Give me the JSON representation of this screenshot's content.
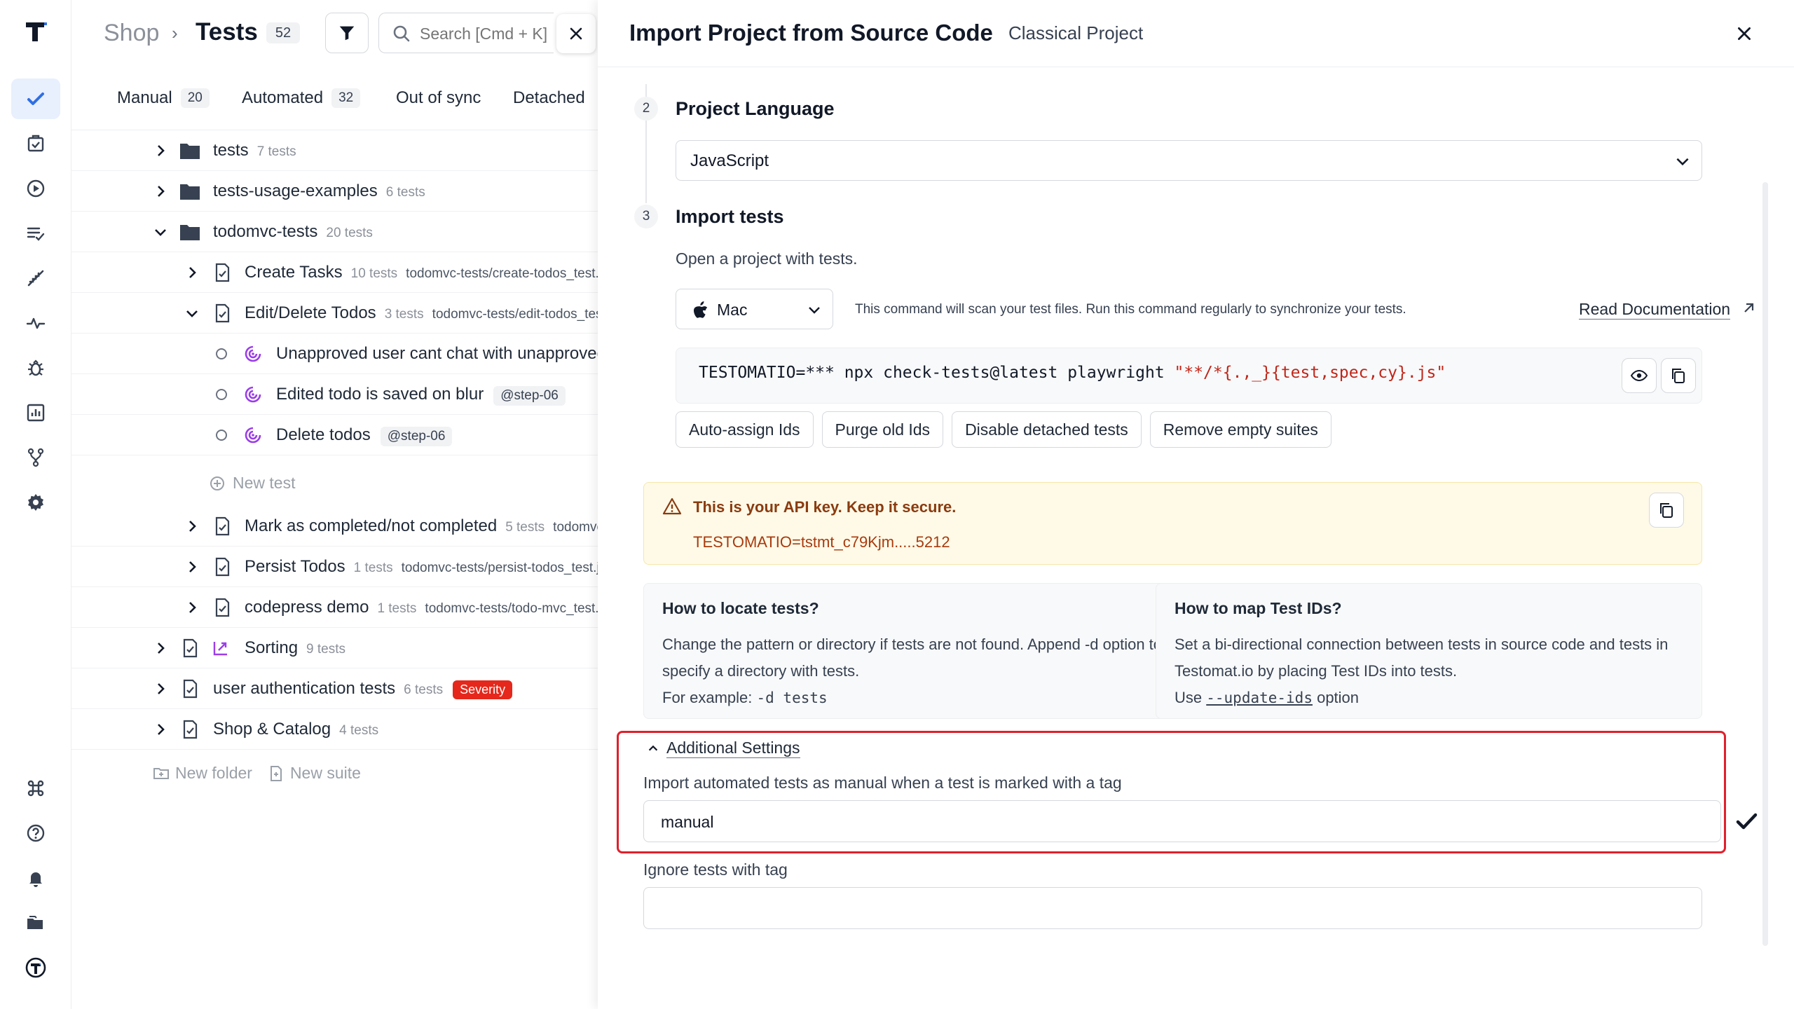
{
  "breadcrumb": {
    "shop": "Shop",
    "sep": "›",
    "title": "Tests",
    "count": "52"
  },
  "search": {
    "placeholder": "Search [Cmd + K]"
  },
  "tabs": [
    {
      "label": "Manual",
      "count": "20"
    },
    {
      "label": "Automated",
      "count": "32"
    },
    {
      "label": "Out of sync"
    },
    {
      "label": "Detached"
    }
  ],
  "tree": {
    "tests": {
      "name": "tests",
      "meta": "7 tests"
    },
    "usage": {
      "name": "tests-usage-examples",
      "meta": "6 tests"
    },
    "todomvc": {
      "name": "todomvc-tests",
      "meta": "20 tests"
    },
    "create": {
      "name": "Create Tasks",
      "meta": "10 tests",
      "path": "todomvc-tests/create-todos_test.js"
    },
    "edit": {
      "name": "Edit/Delete Todos",
      "meta": "3 tests",
      "path": "todomvc-tests/edit-todos_test.js"
    },
    "t1": {
      "name": "Unapproved user cant chat with unapproved"
    },
    "t2": {
      "name": "Edited todo is saved on blur",
      "tag": "@step-06"
    },
    "t3": {
      "name": "Delete todos",
      "tag": "@step-06"
    },
    "new_test": "New test",
    "mark": {
      "name": "Mark as completed/not completed",
      "meta": "5 tests",
      "path": "todomvc-tests/mark"
    },
    "persist": {
      "name": "Persist Todos",
      "meta": "1 tests",
      "path": "todomvc-tests/persist-todos_test.js"
    },
    "codepress": {
      "name": "codepress demo",
      "meta": "1 tests",
      "path": "todomvc-tests/todo-mvc_test.js"
    },
    "sorting": {
      "name": "Sorting",
      "meta": "9 tests"
    },
    "auth": {
      "name": "user authentication tests",
      "meta": "6 tests",
      "badge": "Severity"
    },
    "catalog": {
      "name": "Shop & Catalog",
      "meta": "4 tests"
    },
    "new_folder": "New folder",
    "new_suite": "New suite"
  },
  "panel": {
    "title": "Import Project from Source Code",
    "subtitle": "Classical Project",
    "step2": {
      "num": "2",
      "title": "Project Language",
      "language": "JavaScript"
    },
    "step3": {
      "num": "3",
      "title": "Import tests",
      "open_text": "Open a project with tests.",
      "os": "Mac",
      "cmd_desc": "This command will scan your test files. Run this command regularly to synchronize your tests.",
      "read_doc": "Read Documentation",
      "code_prefix": "TESTOMATIO=*** npx check-tests@latest playwright ",
      "code_pattern": "\"**/*{.,_}{test,spec,cy}.js\""
    },
    "options": [
      "Auto-assign Ids",
      "Purge old Ids",
      "Disable detached tests",
      "Remove empty suites"
    ],
    "api_alert": {
      "title": "This is your API key. Keep it secure.",
      "key": "TESTOMATIO=tstmt_c79Kjm.....5212"
    },
    "locate": {
      "title": "How to locate tests?",
      "line1": "Change the pattern or directory if tests are not found. Append -d option to specify a directory with tests.",
      "example_prefix": "For example: ",
      "example_code": "-d tests"
    },
    "map": {
      "title": "How to map Test IDs?",
      "line1": "Set a bi-directional connection between tests in source code and tests in Testomat.io by placing Test IDs into tests.",
      "use_prefix": "Use ",
      "use_code": "--update-ids",
      "use_suffix": " option"
    },
    "additional": {
      "toggle": "Additional Settings",
      "manual_label": "Import automated tests as manual when a test is marked with a tag",
      "manual_value": "manual",
      "ignore_label": "Ignore tests with tag",
      "ignore_value": ""
    }
  },
  "colors": {
    "accent": "#2f6fe4",
    "danger": "#e5281b",
    "highlight": "#e0202b",
    "warning_bg": "#fffae8"
  }
}
